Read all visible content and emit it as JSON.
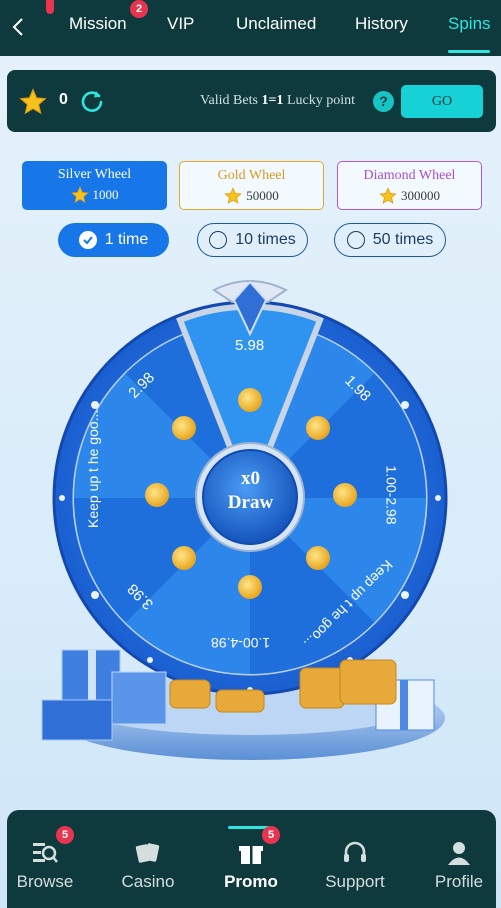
{
  "nav": {
    "back_label": "back",
    "tabs": [
      {
        "label": "Mission",
        "badge": "2"
      },
      {
        "label": "VIP"
      },
      {
        "label": "Unclaimed"
      },
      {
        "label": "History"
      },
      {
        "label": "Spins",
        "active": true
      }
    ]
  },
  "points": {
    "value": "0",
    "valid_prefix": "Valid Bets",
    "ratio": "1=1",
    "valid_suffix": "Lucky point",
    "help": "?",
    "go_label": "GO"
  },
  "wheels": [
    {
      "name": "Silver Wheel",
      "cost": "1000",
      "selected": true
    },
    {
      "name": "Gold Wheel",
      "cost": "50000"
    },
    {
      "name": "Diamond Wheel",
      "cost": "300000"
    }
  ],
  "times": [
    {
      "label": "1 time",
      "selected": true
    },
    {
      "label": "10 times"
    },
    {
      "label": "50 times"
    }
  ],
  "wheel": {
    "segments": [
      "5.98",
      "1.98",
      "1.00-2.98",
      "Keep up t he goo...",
      "1.00-4.98",
      "3.98",
      "Keep up t he goo...",
      "2.98"
    ],
    "center_count": "x0",
    "center_label": "Draw"
  },
  "bottom_nav": [
    {
      "label": "Browse",
      "badge": "5",
      "icon": "browse-icon"
    },
    {
      "label": "Casino",
      "icon": "cards-icon"
    },
    {
      "label": "Promo",
      "badge": "5",
      "icon": "gift-icon",
      "active": true
    },
    {
      "label": "Support",
      "icon": "headset-icon"
    },
    {
      "label": "Profile",
      "icon": "user-icon"
    }
  ],
  "colors": {
    "nav_bg": "#0e3a3d",
    "accent": "#2ee6e0",
    "primary_blue": "#1877e8",
    "badge_red": "#e8344e"
  }
}
